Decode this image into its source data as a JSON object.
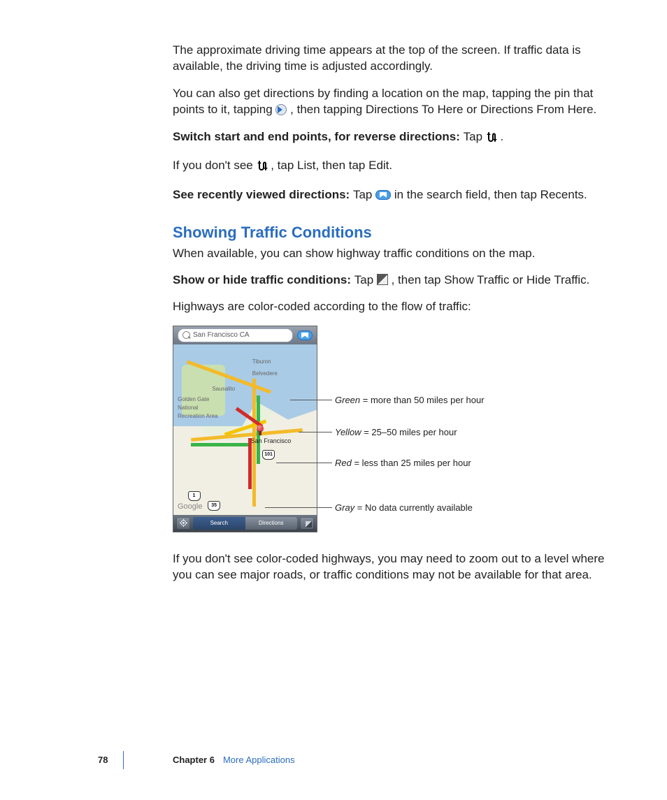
{
  "paragraphs": {
    "p1": "The approximate driving time appears at the top of the screen. If traffic data is available, the driving time is adjusted accordingly.",
    "p2a": "You can also get directions by finding a location on the map, tapping the pin that points to it, tapping ",
    "p2b": ", then tapping Directions To Here or Directions From Here.",
    "p3_bold": "Switch start and end points, for reverse directions:  ",
    "p3_tap": "Tap ",
    "p3_end": ".",
    "p4a": "If you don't see ",
    "p4b": ", tap List, then tap Edit.",
    "p5_bold": "See recently viewed directions:  ",
    "p5_tap": "Tap ",
    "p5_end": " in the search field, then tap Recents.",
    "h2": "Showing Traffic Conditions",
    "p6": "When available, you can show highway traffic conditions on the map.",
    "p7_bold": "Show or hide traffic conditions:  ",
    "p7_tap": "Tap ",
    "p7_end": ", then tap Show Traffic or Hide Traffic.",
    "p8": "Highways are color-coded according to the flow of traffic:",
    "p9": "If you don't see color-coded highways, you may need to zoom out to a level where you can see major roads, or traffic conditions may not be available for that area."
  },
  "phone": {
    "search_value": "San Francisco CA",
    "city_label": "San Francisco",
    "labels": {
      "tiburon": "Tiburon",
      "belvedere": "Belvedere",
      "sausalito": "Sausalito",
      "ggnra1": "Golden Gate",
      "ggnra2": "National",
      "ggnra3": "Recreation Area"
    },
    "shields": {
      "s1": "1",
      "s35": "35",
      "s101": "101"
    },
    "google": "Google",
    "seg_search": "Search",
    "seg_directions": "Directions"
  },
  "callouts": {
    "green_i": "Green",
    "green_t": " = more than 50 miles per hour",
    "yellow_i": "Yellow",
    "yellow_t": " = 25–50 miles per hour",
    "red_i": "Red",
    "red_t": " = less than 25 miles per hour",
    "gray_i": "Gray",
    "gray_t": " = No data currently available"
  },
  "footer": {
    "page": "78",
    "chapter_label": "Chapter 6",
    "chapter_title": "More Applications"
  }
}
